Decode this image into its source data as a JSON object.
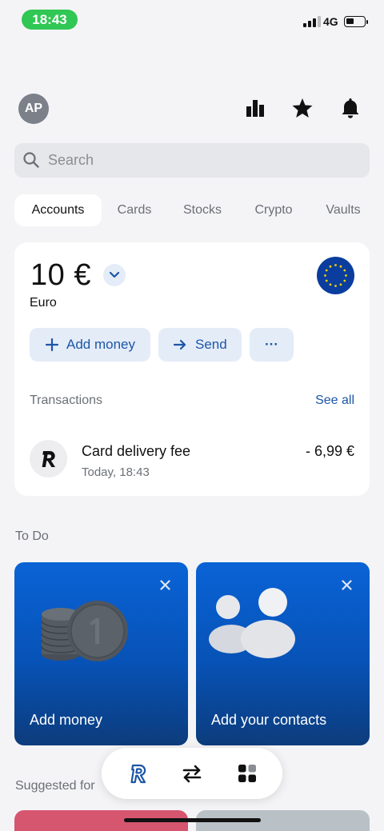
{
  "status_bar": {
    "time": "18:43",
    "network": "4G"
  },
  "header": {
    "avatar_initials": "AP",
    "icons": [
      "bar-chart-icon",
      "star-icon",
      "bell-icon"
    ]
  },
  "search": {
    "placeholder": "Search",
    "value": ""
  },
  "tabs": [
    {
      "label": "Accounts",
      "active": true
    },
    {
      "label": "Cards",
      "active": false
    },
    {
      "label": "Stocks",
      "active": false
    },
    {
      "label": "Crypto",
      "active": false
    },
    {
      "label": "Vaults",
      "active": false
    }
  ],
  "account": {
    "balance": "10 €",
    "currency": "Euro",
    "actions": {
      "add_money": "Add money",
      "send": "Send",
      "more": "···"
    },
    "transactions_title": "Transactions",
    "see_all": "See all",
    "transactions": [
      {
        "name": "Card delivery fee",
        "date": "Today, 18:43",
        "amount": "- 6,99 €"
      }
    ]
  },
  "todo": {
    "title": "To Do",
    "cards": [
      {
        "label": "Add money"
      },
      {
        "label": "Add your contacts"
      }
    ]
  },
  "suggested": {
    "title": "Suggested for"
  },
  "colors": {
    "accent": "#1d56a6",
    "todo_blue": "#0752b6",
    "status_green": "#30c754"
  }
}
